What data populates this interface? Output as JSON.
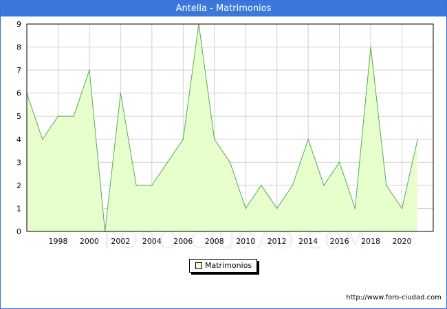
{
  "header": {
    "title": "Antella - Matrimonios"
  },
  "footer": {
    "url": "http://www.foro-ciudad.com"
  },
  "watermark": {
    "text": "FORO-CIUDAD.COM"
  },
  "chart_data": {
    "type": "area",
    "title": "Antella - Matrimonios",
    "x": [
      1996,
      1997,
      1998,
      1999,
      2000,
      2001,
      2002,
      2003,
      2004,
      2005,
      2006,
      2007,
      2008,
      2009,
      2010,
      2011,
      2012,
      2013,
      2014,
      2015,
      2016,
      2017,
      2018,
      2019,
      2020,
      2021
    ],
    "series": [
      {
        "name": "Matrimonios",
        "values": [
          6,
          4,
          5,
          5,
          7,
          0,
          6,
          2,
          2,
          3,
          4,
          9,
          4,
          3,
          1,
          2,
          1,
          2,
          4,
          2,
          3,
          1,
          8,
          2,
          1,
          4
        ]
      }
    ],
    "xticks": [
      "1998",
      "2000",
      "2002",
      "2004",
      "2006",
      "2008",
      "2010",
      "2012",
      "2014",
      "2016",
      "2018",
      "2020"
    ],
    "yticks": [
      "0",
      "1",
      "2",
      "3",
      "4",
      "5",
      "6",
      "7",
      "8",
      "9"
    ],
    "ylim": [
      0,
      9
    ],
    "xlim": [
      1996,
      2022
    ],
    "grid": true,
    "legend": "bottom-center",
    "fill_color": "#e6ffcc",
    "line_color": "#55aa55"
  }
}
